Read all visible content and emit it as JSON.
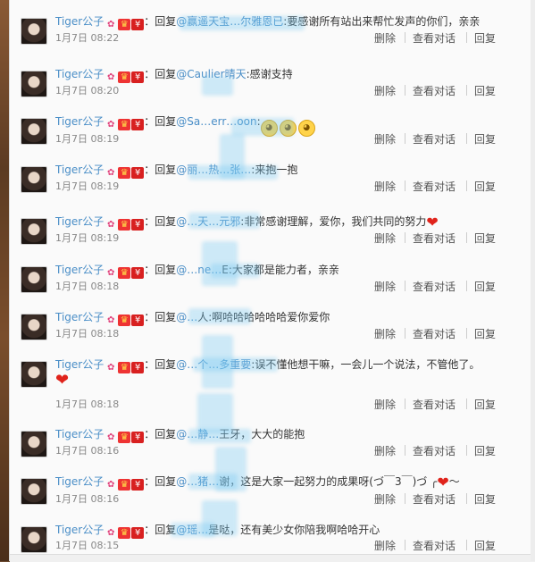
{
  "username": "Tiger公子",
  "icons": [
    "ribbon-icon",
    "vip-hat-icon",
    "gift-icon"
  ],
  "actions": {
    "delete": "删除",
    "conversation": "查看对话",
    "reply": "回复"
  },
  "items": [
    {
      "reply_prefix": "回复",
      "mention": "@赢遥天宝…尔雅恩已",
      "text": ":要感谢所有站出来帮忙发声的你们，亲亲",
      "time": "1月7日 08:22"
    },
    {
      "reply_prefix": "回复",
      "mention": "@Caulier晴天",
      "text": ":感谢支持",
      "time": "1月7日 08:20"
    },
    {
      "reply_prefix": "回复",
      "mention": "@Sa…err…oon",
      "text": ":",
      "emoticons": 3,
      "time": "1月7日 08:19"
    },
    {
      "reply_prefix": "回复",
      "mention": "@丽…热…张…",
      "text": ":来抱一抱",
      "time": "1月7日 08:19"
    },
    {
      "reply_prefix": "回复",
      "mention": "@…天…元邪",
      "text": ":非常感谢理解，爱你，我们共同的努力",
      "heart": true,
      "time": "1月7日 08:19"
    },
    {
      "reply_prefix": "回复",
      "mention": "@…ne…",
      "text": "E:大家都是能力者，亲亲",
      "time": "1月7日 08:18"
    },
    {
      "reply_prefix": "回复",
      "mention": "@…",
      "text": "人:啊哈哈哈哈哈哈爱你爱你",
      "time": "1月7日 08:18"
    },
    {
      "reply_prefix": "回复",
      "mention": "@…个…多重要",
      "text": ":误不懂他想干嘛，一会儿一个说法，不管他了。",
      "heart_line2": true,
      "time": "1月7日 08:18"
    },
    {
      "reply_prefix": "回复",
      "mention": "@…静…",
      "text": "王牙，大大的能抱",
      "time": "1月7日 08:16"
    },
    {
      "reply_prefix": "回复",
      "mention": "@…猪…",
      "text": "谢，这是大家一起努力的成果呀(づ￣3￣)づ ╭",
      "heart_end": true,
      "tail": "～",
      "time": "1月7日 08:16"
    },
    {
      "reply_prefix": "回复",
      "mention": "@瑶…",
      "text": "是哒，还有美少女你陪我啊哈哈开心",
      "time": "1月7日 08:15"
    }
  ]
}
